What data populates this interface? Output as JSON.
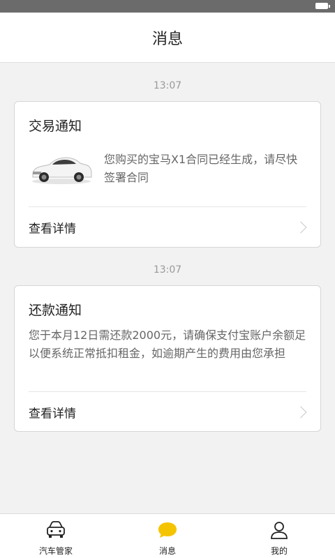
{
  "header": {
    "title": "消息"
  },
  "messages": [
    {
      "time": "13:07",
      "title": "交易通知",
      "body": "您购买的宝马X1合同已经生成，请尽快签署合同",
      "image_icon": "car-thumbnail",
      "detail_label": "查看详情"
    },
    {
      "time": "13:07",
      "title": "还款通知",
      "body": "您于本月12日需还款2000元，请确保支付宝账户余额足以便系统正常抵扣租金，如逾期产生的费用由您承担",
      "detail_label": "查看详情"
    }
  ],
  "tabbar": {
    "items": [
      {
        "label": "汽车管家",
        "icon": "car-icon",
        "active": false
      },
      {
        "label": "消息",
        "icon": "message-bubble-icon",
        "active": true
      },
      {
        "label": "我的",
        "icon": "user-icon",
        "active": false
      }
    ]
  },
  "colors": {
    "accent": "#f5c400",
    "text": "#222222",
    "secondary_text": "#666666",
    "background": "#f2f2f2"
  }
}
